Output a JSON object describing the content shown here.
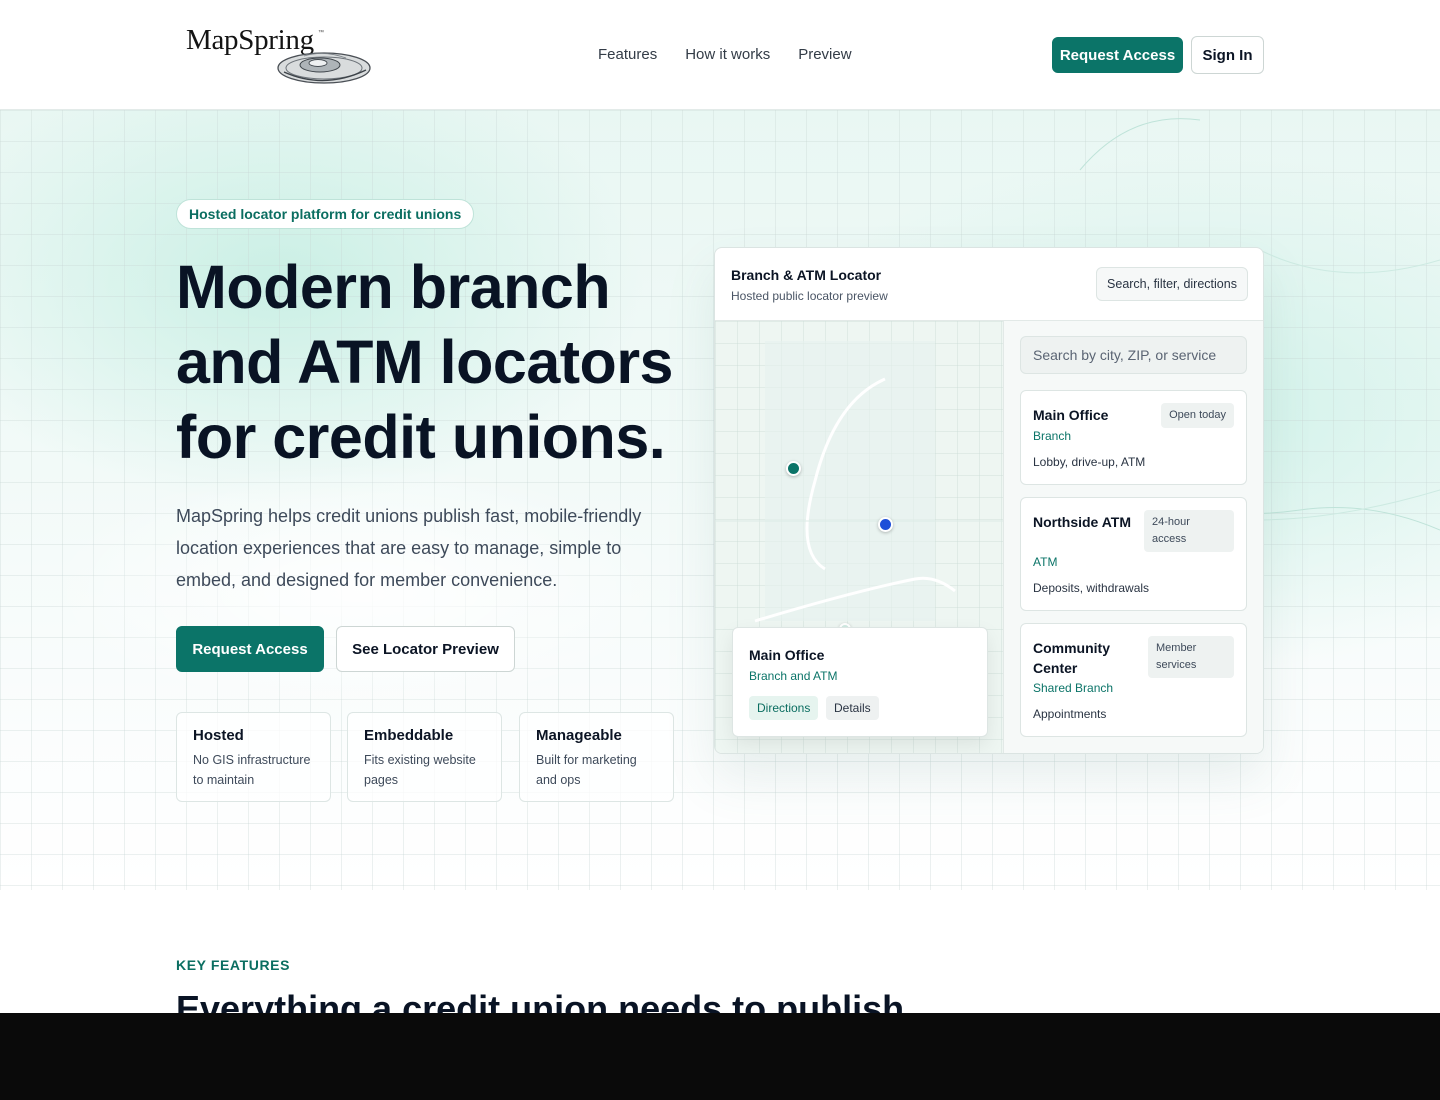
{
  "brand": {
    "name": "MapSpring",
    "tm": "™"
  },
  "nav": {
    "items": [
      {
        "label": "Features"
      },
      {
        "label": "How it works"
      },
      {
        "label": "Preview"
      }
    ]
  },
  "header": {
    "request_access": "Request Access",
    "sign_in": "Sign In"
  },
  "hero": {
    "pill": "Hosted locator platform for credit unions",
    "title": "Modern branch and ATM locators for credit unions.",
    "description": "MapSpring helps credit unions publish fast, mobile-friendly location experiences that are easy to manage, simple to embed, and designed for member convenience.",
    "cta_primary": "Request Access",
    "cta_secondary": "See Locator Preview",
    "features": [
      {
        "title": "Hosted",
        "text": "No GIS infrastructure to maintain"
      },
      {
        "title": "Embeddable",
        "text": "Fits existing website pages"
      },
      {
        "title": "Manageable",
        "text": "Built for marketing and ops"
      }
    ]
  },
  "locator": {
    "title": "Branch & ATM Locator",
    "subtitle": "Hosted public locator preview",
    "chip": "Search, filter, directions",
    "search_placeholder": "Search by city, ZIP, or service",
    "popup": {
      "title": "Main Office",
      "subtitle": "Branch and ATM",
      "directions": "Directions",
      "details": "Details"
    },
    "items": [
      {
        "name": "Main Office",
        "type": "Branch",
        "desc": "Lobby, drive-up, ATM",
        "badge": "Open today"
      },
      {
        "name": "Northside ATM",
        "type": "ATM",
        "desc": "Deposits, withdrawals",
        "badge": "24-hour access"
      },
      {
        "name": "Community Center",
        "type": "Shared Branch",
        "desc": "Appointments",
        "badge": "Member services"
      }
    ]
  },
  "key_features": {
    "label": "KEY FEATURES",
    "title": "Everything a credit union needs to publish"
  },
  "colors": {
    "brand": "#0b7468",
    "pin_primary": "#0b7468",
    "pin_secondary": "#1d4ed8",
    "heading": "#091324"
  }
}
